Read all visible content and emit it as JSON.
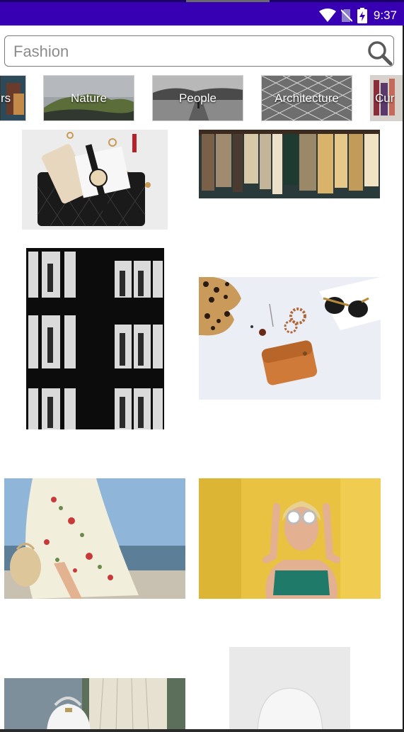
{
  "status_bar": {
    "time": "9:37",
    "background": "#3700b3",
    "icons": [
      "wifi-icon",
      "no-sim-icon",
      "battery-charging-icon"
    ]
  },
  "search": {
    "placeholder": "Fashion",
    "value": "",
    "icon": "search-icon"
  },
  "categories": [
    {
      "label": "rs",
      "full_label_hint": "partially visible"
    },
    {
      "label": "Nature"
    },
    {
      "label": "People"
    },
    {
      "label": "Architecture"
    },
    {
      "label": "Cur"
    }
  ],
  "photos": [
    {
      "subject": "handbag with phone, watch and notebook"
    },
    {
      "subject": "clothes rack"
    },
    {
      "subject": "mannequins in lit windows"
    },
    {
      "subject": "flatlay with leopard shoes, sunglasses and wallet"
    },
    {
      "subject": "woman in floral dress by the sea"
    },
    {
      "subject": "woman with sunglasses against yellow wall"
    },
    {
      "subject": "woman holding white bag"
    },
    {
      "subject": "white chair on light background"
    }
  ],
  "colors": {
    "accent": "#3700b3",
    "search_border": "#7a7a7a",
    "placeholder": "#8c8c8c"
  }
}
